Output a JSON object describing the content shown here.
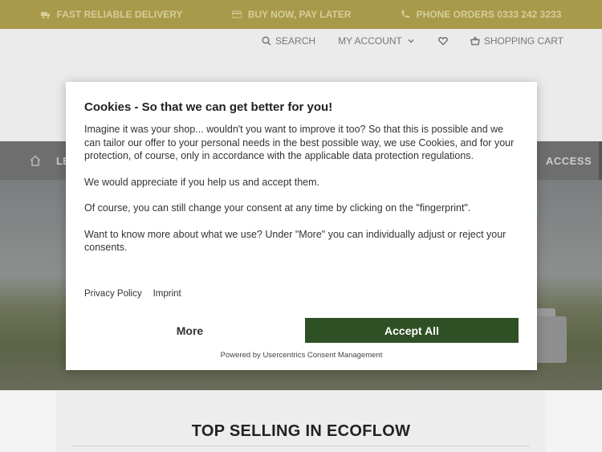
{
  "topbar": {
    "items": [
      {
        "label": "FAST RELIABLE DELIVERY",
        "icon": "truck-icon"
      },
      {
        "label": "BUY NOW, PAY LATER",
        "icon": "credit-card-icon"
      },
      {
        "label": "PHONE ORDERS 0333 242 3233",
        "icon": "phone-icon"
      }
    ]
  },
  "header": {
    "search_label": "SEARCH",
    "account_label": "MY ACCOUNT",
    "cart_label": "SHOPPING CART"
  },
  "mainnav": {
    "first_label": "LE",
    "last_label": "ACCESS"
  },
  "section": {
    "title": "TOP SELLING IN ECOFLOW"
  },
  "modal": {
    "title": "Cookies - So that we can get better for you!",
    "paragraphs": [
      "Imagine it was your shop... wouldn't you want to improve it too? So that this is possible and we can tailor our offer to your personal needs in the best possible way, we use Cookies, and for your protection, of course, only in accordance with the applicable data protection regulations.",
      "We would appreciate if you help us and accept them.",
      "Of course, you can still change your consent at any time by clicking on the \"fingerprint\".",
      "Want to know more about what we use? Under \"More\" you can individually adjust or reject your consents."
    ],
    "privacy_link": "Privacy Policy",
    "imprint_link": "Imprint",
    "more_button": "More",
    "accept_button": "Accept All",
    "powered_by": "Powered by Usercentrics Consent Management"
  },
  "colors": {
    "topbar_bg": "#a89a4a",
    "accept_bg": "#2f5024",
    "nav_bg": "#6e6e6e"
  }
}
